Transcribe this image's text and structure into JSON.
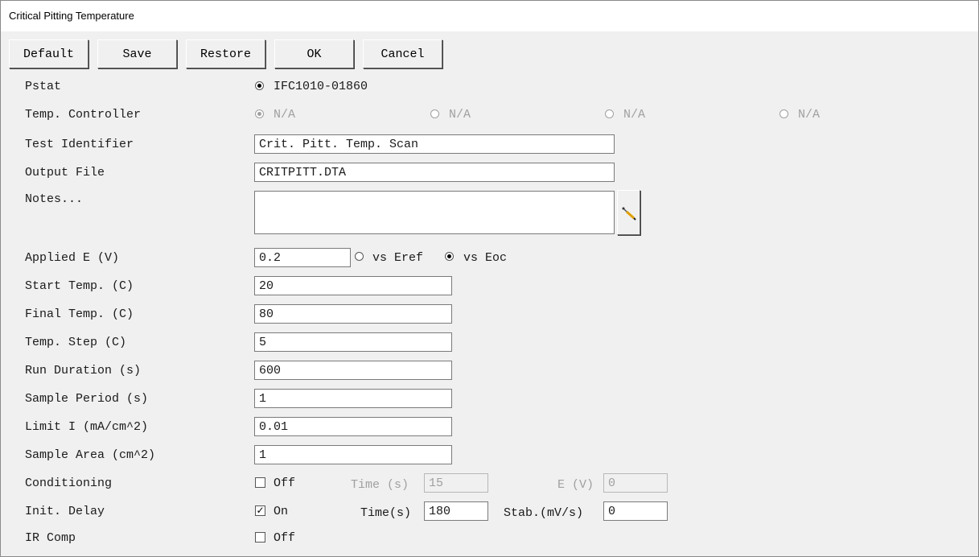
{
  "window": {
    "title": "Critical Pitting Temperature"
  },
  "buttons": {
    "default": "Default",
    "save": "Save",
    "restore": "Restore",
    "ok": "OK",
    "cancel": "Cancel"
  },
  "pstat": {
    "label": "Pstat",
    "option": "IFC1010-01860",
    "selected": true
  },
  "temp_controller": {
    "label": "Temp. Controller",
    "options": [
      "N/A",
      "N/A",
      "N/A",
      "N/A"
    ],
    "selected_index": 0
  },
  "test_identifier": {
    "label": "Test Identifier",
    "value": "Crit. Pitt. Temp. Scan"
  },
  "output_file": {
    "label": "Output File",
    "value": "CRITPITT.DTA"
  },
  "notes": {
    "label": "Notes...",
    "value": "",
    "edit_icon": "pencil-icon"
  },
  "applied_e": {
    "label": "Applied E (V)",
    "value": "0.2",
    "vs_eref": "vs Eref",
    "vs_eoc": "vs Eoc",
    "selected": "vs Eoc"
  },
  "start_temp": {
    "label": "Start Temp. (C)",
    "value": "20"
  },
  "final_temp": {
    "label": "Final Temp. (C)",
    "value": "80"
  },
  "temp_step": {
    "label": "Temp. Step (C)",
    "value": "5"
  },
  "run_duration": {
    "label": "Run Duration (s)",
    "value": "600"
  },
  "sample_period": {
    "label": "Sample Period (s)",
    "value": "1"
  },
  "limit_i": {
    "label": "Limit I (mA/cm^2)",
    "value": "0.01"
  },
  "sample_area": {
    "label": "Sample Area (cm^2)",
    "value": "1"
  },
  "conditioning": {
    "label": "Conditioning",
    "state": "Off",
    "checked": false,
    "time_label": "Time (s)",
    "time_value": "15",
    "e_label": "E (V)",
    "e_value": "0"
  },
  "init_delay": {
    "label": "Init. Delay",
    "state": "On",
    "checked": true,
    "time_label": "Time(s)",
    "time_value": "180",
    "stab_label": "Stab.(mV/s)",
    "stab_value": "0"
  },
  "ir_comp": {
    "label": "IR Comp",
    "state": "Off",
    "checked": false
  }
}
